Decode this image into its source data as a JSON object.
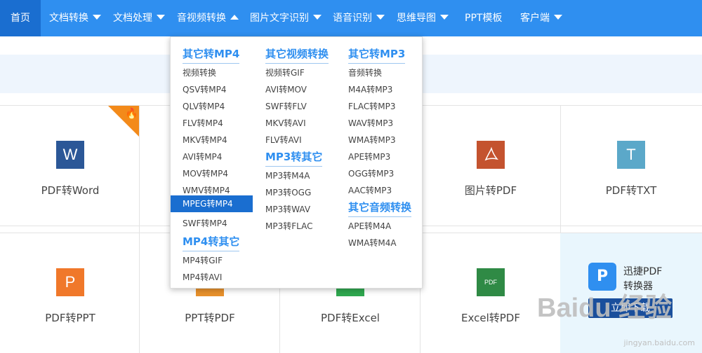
{
  "nav": {
    "items": [
      {
        "label": "首页"
      },
      {
        "label": "文档转换"
      },
      {
        "label": "文档处理"
      },
      {
        "label": "音视频转换"
      },
      {
        "label": "图片文字识别"
      },
      {
        "label": "语音识别"
      },
      {
        "label": "思维导图"
      },
      {
        "label": "PPT模板"
      },
      {
        "label": "客户端"
      }
    ]
  },
  "dropdown": {
    "col1": {
      "heading1": "其它转MP4",
      "items1": [
        "视频转换",
        "QSV转MP4",
        "QLV转MP4",
        "FLV转MP4",
        "MKV转MP4",
        "AVI转MP4",
        "MOV转MP4",
        "WMV转MP4",
        "MPEG转MP4",
        "SWF转MP4"
      ],
      "heading2": "MP4转其它",
      "items2": [
        "MP4转GIF",
        "MP4转AVI"
      ]
    },
    "col2": {
      "heading1": "其它视频转换",
      "items1": [
        "视频转GIF",
        "AVI转MOV",
        "SWF转FLV",
        "MKV转AVI",
        "FLV转AVI"
      ],
      "heading2": "MP3转其它",
      "items2": [
        "MP3转M4A",
        "MP3转OGG",
        "MP3转WAV",
        "MP3转FLAC"
      ]
    },
    "col3": {
      "heading1": "其它转MP3",
      "items1": [
        "音频转换",
        "M4A转MP3",
        "FLAC转MP3",
        "WAV转MP3",
        "WMA转MP3",
        "APE转MP3",
        "OGG转MP3",
        "AAC转MP3"
      ],
      "heading2": "其它音频转换",
      "items2": [
        "APE转M4A",
        "WMA转M4A"
      ]
    }
  },
  "tiles": [
    {
      "label": "PDF转Word",
      "icon": "W",
      "color": "#2b5797"
    },
    {
      "label": "图片转PDF",
      "icon": "pdf",
      "color": "#c4532f"
    },
    {
      "label": "PDF转TXT",
      "icon": "T",
      "color": "#5ba8c9"
    },
    {
      "label": "PDF转PPT",
      "icon": "P",
      "color": "#f0782a"
    },
    {
      "label": "PPT转PDF",
      "icon": "",
      "color": "#e8912c"
    },
    {
      "label": "PDF转Excel",
      "icon": "",
      "color": "#2fa84f"
    },
    {
      "label": "Excel转PDF",
      "icon": "PDF",
      "color": "#2f8a45"
    }
  ],
  "promo": {
    "logo": "P",
    "line1": "迅捷PDF",
    "line2": "转换器",
    "button": "立即下载"
  },
  "watermark": {
    "big": "Baidu 经验",
    "small": "jingyan.baidu.com"
  }
}
